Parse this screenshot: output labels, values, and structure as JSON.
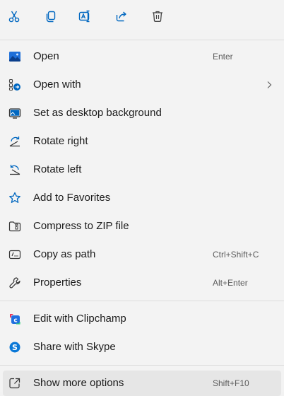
{
  "quick_actions": [
    {
      "icon": "cut-icon"
    },
    {
      "icon": "copy-icon"
    },
    {
      "icon": "rename-icon"
    },
    {
      "icon": "share-icon"
    },
    {
      "icon": "delete-icon"
    }
  ],
  "menu": {
    "open": {
      "label": "Open",
      "shortcut": "Enter"
    },
    "open_with": {
      "label": "Open with"
    },
    "set_desktop_background": {
      "label": "Set as desktop background"
    },
    "rotate_right": {
      "label": "Rotate right"
    },
    "rotate_left": {
      "label": "Rotate left"
    },
    "add_to_favorites": {
      "label": "Add to Favorites"
    },
    "compress_zip": {
      "label": "Compress to ZIP file"
    },
    "copy_as_path": {
      "label": "Copy as path",
      "shortcut": "Ctrl+Shift+C"
    },
    "properties": {
      "label": "Properties",
      "shortcut": "Alt+Enter"
    },
    "edit_clipchamp": {
      "label": "Edit with Clipchamp"
    },
    "share_skype": {
      "label": "Share with Skype"
    },
    "show_more_options": {
      "label": "Show more options",
      "shortcut": "Shift+F10"
    }
  },
  "colors": {
    "accent": "#0067c0",
    "clipchamp": "#1f6fe0",
    "skype": "#0a78d7",
    "background": "#f3f3f3",
    "hover": "#e6e6e6"
  }
}
